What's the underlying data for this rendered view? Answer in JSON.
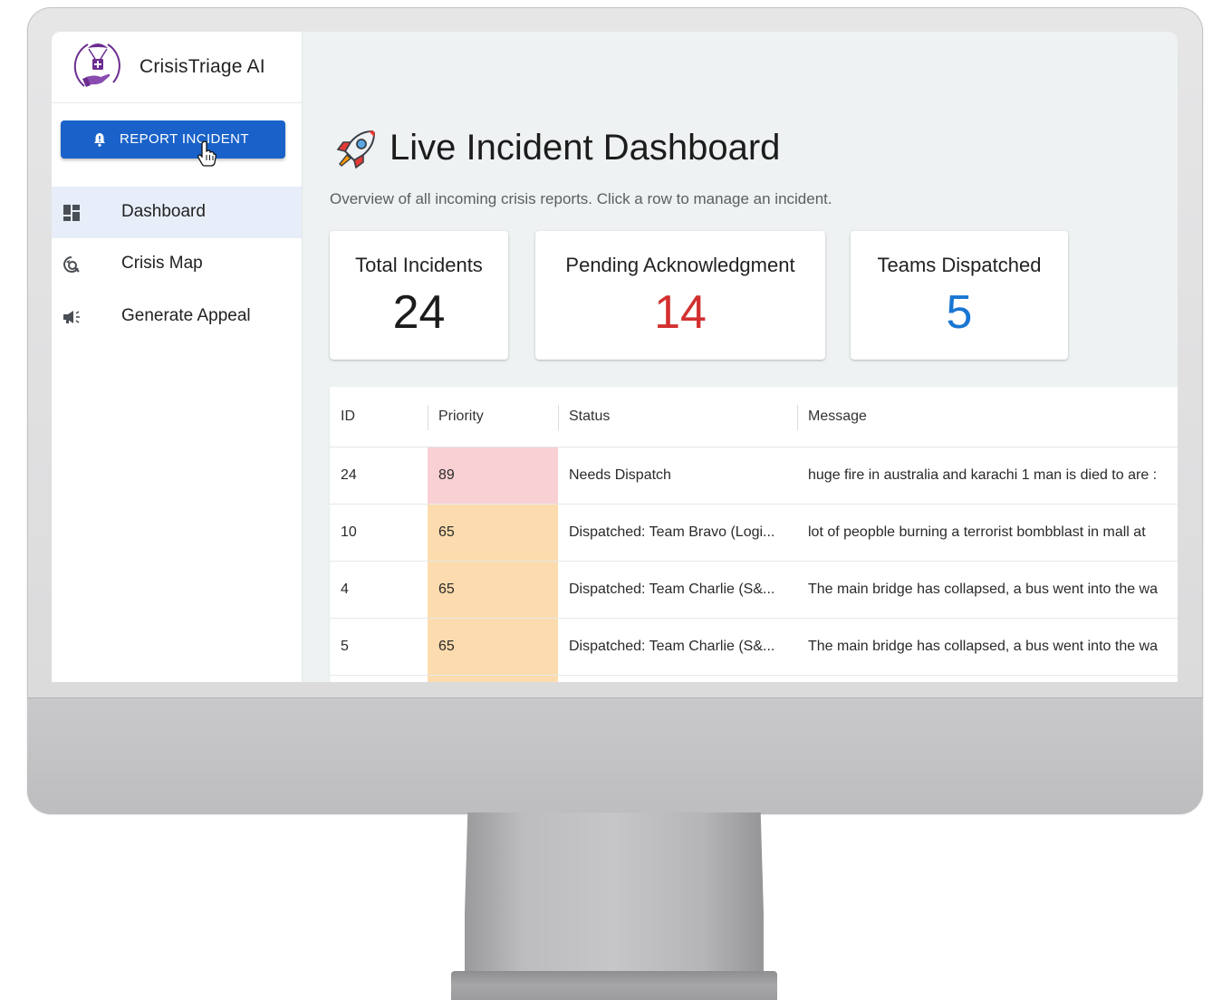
{
  "app": {
    "name": "CrisisTriage AI"
  },
  "sidebar": {
    "report_button": "REPORT INCIDENT",
    "items": [
      {
        "label": "Dashboard",
        "icon": "dashboard-icon",
        "active": true
      },
      {
        "label": "Crisis Map",
        "icon": "map-search-icon",
        "active": false
      },
      {
        "label": "Generate Appeal",
        "icon": "megaphone-icon",
        "active": false
      }
    ]
  },
  "main": {
    "title": "Live Incident Dashboard",
    "title_icon": "rocket-icon",
    "subtitle": "Overview of all incoming crisis reports. Click a row to manage an incident."
  },
  "stats": [
    {
      "label": "Total Incidents",
      "value": "24",
      "color": "#1c1c1c"
    },
    {
      "label": "Pending Acknowledgment",
      "value": "14",
      "color": "#d32f2f"
    },
    {
      "label": "Teams Dispatched",
      "value": "5",
      "color": "#1976d2"
    }
  ],
  "table": {
    "columns": [
      "ID",
      "Priority",
      "Status",
      "Message"
    ],
    "rows": [
      {
        "id": "24",
        "priority": "89",
        "priority_color": "#f9d0d4",
        "status": "Needs Dispatch",
        "message": "huge fire in australia and karachi 1 man is died to are :"
      },
      {
        "id": "10",
        "priority": "65",
        "priority_color": "#fcdcae",
        "status": "Dispatched: Team Bravo (Logi...",
        "message": "lot of peopble burning a terrorist bombblast in mall at"
      },
      {
        "id": "4",
        "priority": "65",
        "priority_color": "#fcdcae",
        "status": "Dispatched: Team Charlie (S&...",
        "message": "The main bridge has collapsed, a bus went into the wa"
      },
      {
        "id": "5",
        "priority": "65",
        "priority_color": "#fcdcae",
        "status": "Dispatched: Team Charlie (S&...",
        "message": "The main bridge has collapsed, a bus went into the wa"
      }
    ]
  },
  "colors": {
    "brand_purple": "#6b2d8f",
    "primary_button": "#1a62c9",
    "active_nav": "#e7eef9",
    "screen_background": "#eef2f3"
  }
}
